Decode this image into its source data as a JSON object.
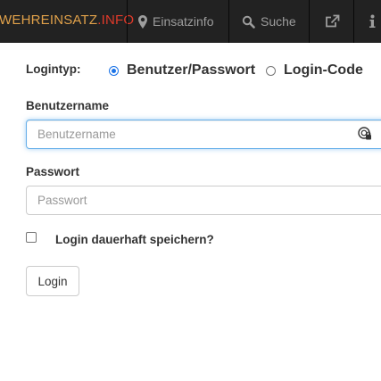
{
  "navbar": {
    "brand_part1": "WEHREINSATZ",
    "brand_part2": ".INFO",
    "items": [
      {
        "label": "Einsatzinfo",
        "icon": "map-marker-icon"
      },
      {
        "label": "Suche",
        "icon": "search-icon"
      },
      {
        "label": "",
        "icon": "external-link-icon"
      },
      {
        "label": "",
        "icon": "info-icon"
      }
    ]
  },
  "login": {
    "type_label": "Logintyp:",
    "options": [
      {
        "label": "Benutzer/Passwort",
        "selected": true
      },
      {
        "label": "Login-Code",
        "selected": false
      }
    ],
    "username_label": "Benutzername",
    "username_placeholder": "Benutzername",
    "username_value": "",
    "password_label": "Passwort",
    "password_placeholder": "Passwort",
    "remember_label": "Login dauerhaft speichern?",
    "remember_checked": false,
    "submit_label": "Login"
  },
  "colors": {
    "navbar_bg": "#222222",
    "brand_orange": "#e0a14a",
    "brand_red": "#e03a2a",
    "focus_blue": "#66afe9",
    "radio_blue": "#1a73e8"
  }
}
